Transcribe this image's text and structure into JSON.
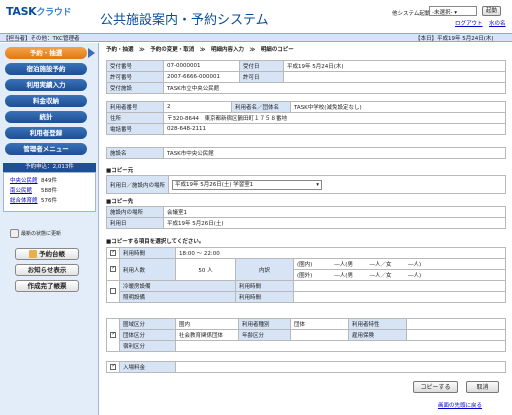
{
  "header": {
    "logo": "TASK",
    "logo_sub": "クラウド",
    "app_title": "公共施設案内・予約システム",
    "system_label": "他システム起動：",
    "system_select": "-未選択-",
    "launch_button": "起動",
    "logout": "ログアウト",
    "about": "水の名"
  },
  "bar": {
    "user": "【担当者】その他：TKC管理者",
    "today": "【本日】平成19年 5月24日(木)"
  },
  "menu": [
    {
      "label": "予約・抽選",
      "active": true
    },
    {
      "label": "宿泊施設予約",
      "active": false
    },
    {
      "label": "利用実績入力",
      "active": false
    },
    {
      "label": "料金収納",
      "active": false
    },
    {
      "label": "統計",
      "active": false
    },
    {
      "label": "利用者登録",
      "active": false
    },
    {
      "label": "管理者メニュー",
      "active": false
    }
  ],
  "pending": {
    "title": "予約申込：2,013件",
    "items": [
      {
        "name": "中央公民館",
        "count": "849件"
      },
      {
        "name": "南公民館",
        "count": "588件"
      },
      {
        "name": "総合体育館",
        "count": "576件"
      }
    ],
    "refresh": "最新の状態に更新"
  },
  "side_buttons": [
    "予約台帳",
    "お知らせ表示",
    "作成完了帳票"
  ],
  "breadcrumb": "予約・抽選　≫　予約の変更・取消　≫　明細内容入力　≫　明細のコピー",
  "receipt": {
    "receipt_no_label": "受付番号",
    "receipt_no": "07-0000001",
    "receipt_date_label": "受付日",
    "receipt_date": "平成19年 5月24日(木)",
    "permit_no_label": "許可番号",
    "permit_no": "2007-6666-000001",
    "permit_date_label": "許可日",
    "permit_date": "",
    "facility_label": "受付施設",
    "facility": "TASK市立中央公民館"
  },
  "user": {
    "user_no_label": "利用者番号",
    "user_no": "2",
    "user_name_label": "利用者名／団体名",
    "user_name": "TASK中学校(減免設定なし)",
    "address_label": "住所",
    "address": "〒320-8644　東京都新宿区鶴田町１７５８番地",
    "phone_label": "電話番号",
    "phone": "028-648-2111"
  },
  "facility_name": {
    "label": "施設名",
    "value": "TASK市中央公民館"
  },
  "copy_from": {
    "title": "■コピー元",
    "label": "利用日／施設内の場所",
    "value": "平成19年 5月26日(土)  学習室1"
  },
  "copy_to": {
    "title": "■コピー先",
    "place_label": "施設内の場所",
    "place": "会議室1",
    "date_label": "利用日",
    "date": "平成19年 5月26日(土)"
  },
  "select_items": {
    "title": "■コピーする項目を選択してください。",
    "use_time_label": "利用時間",
    "use_time": "18:00 ～ 22:00",
    "people_label": "利用人数",
    "people": "50 人",
    "breakdown_label": "内訳",
    "breakdown_in": "(圏内)　　　　―人(男　　　―人／女　　　―人)",
    "breakdown_out": "(圏外)　　　　―人(男　　　―人／女　　　―人)",
    "cold_label": "冷暖房設備",
    "cold_time_label": "利用時間",
    "light_label": "照明設備",
    "light_time_label": "利用時間",
    "area_label": "圏域区分",
    "area": "圏内",
    "user_type_label": "利用者種別",
    "user_type": "団体",
    "user_attr_label": "利用者特性",
    "user_attr": "",
    "group_label": "団体区分",
    "group": "社会教育関係団体",
    "age_label": "年齢区分",
    "age": "",
    "employ_label": "雇用保険",
    "employ": "",
    "lodging_label": "宿利区分",
    "lodging": "",
    "fee_label": "入場料金",
    "fee": ""
  },
  "actions": {
    "copy": "コピーする",
    "cancel": "取消",
    "top": "画面の先頭に戻る"
  }
}
